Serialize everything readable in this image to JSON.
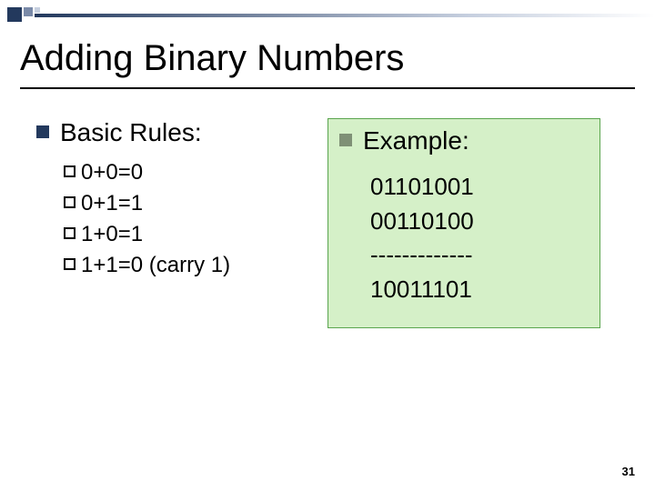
{
  "slide": {
    "title": "Adding Binary Numbers",
    "page_number": "31"
  },
  "left": {
    "heading": "Basic Rules:",
    "rules": [
      "0+0=0",
      "0+1=1",
      "1+0=1",
      "1+1=0 (carry 1)"
    ]
  },
  "right": {
    "heading": "Example:",
    "lines": [
      "01101001",
      "00110100",
      "-------------",
      "10011101"
    ]
  }
}
